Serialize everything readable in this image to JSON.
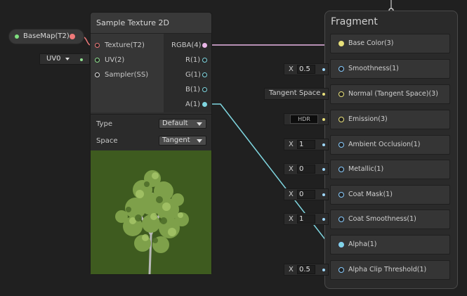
{
  "property_node": {
    "label": "BaseMap(T2)"
  },
  "uv_dropdown": {
    "value": "UV0"
  },
  "sample_texture": {
    "title": "Sample Texture 2D",
    "inputs": [
      {
        "label": "Texture(T2)"
      },
      {
        "label": "UV(2)"
      },
      {
        "label": "Sampler(SS)"
      }
    ],
    "outputs": [
      {
        "label": "RGBA(4)"
      },
      {
        "label": "R(1)"
      },
      {
        "label": "G(1)"
      },
      {
        "label": "B(1)"
      },
      {
        "label": "A(1)"
      }
    ],
    "settings": {
      "type_label": "Type",
      "type_value": "Default",
      "space_label": "Space",
      "space_value": "Tangent"
    }
  },
  "fragment": {
    "title": "Fragment",
    "slots": [
      {
        "label": "Base Color(3)"
      },
      {
        "label": "Smoothness(1)",
        "x_label": "X",
        "value": "0.5"
      },
      {
        "label": "Normal (Tangent Space)(3)",
        "input_text": "Tangent Space"
      },
      {
        "label": "Emission(3)",
        "input_text": "HDR"
      },
      {
        "label": "Ambient Occlusion(1)",
        "x_label": "X",
        "value": "1"
      },
      {
        "label": "Metallic(1)",
        "x_label": "X",
        "value": "0"
      },
      {
        "label": "Coat Mask(1)",
        "x_label": "X",
        "value": "0"
      },
      {
        "label": "Coat Smoothness(1)",
        "x_label": "X",
        "value": "1"
      },
      {
        "label": "Alpha(1)"
      },
      {
        "label": "Alpha Clip Threshold(1)",
        "x_label": "X",
        "value": "0.5"
      }
    ]
  },
  "colors": {
    "background": "#202020",
    "edge_cyan": "#7fd6e0",
    "edge_pink": "#e9b6e6",
    "edge_green": "#8fe08f",
    "port_yellow": "#e8e07a"
  }
}
